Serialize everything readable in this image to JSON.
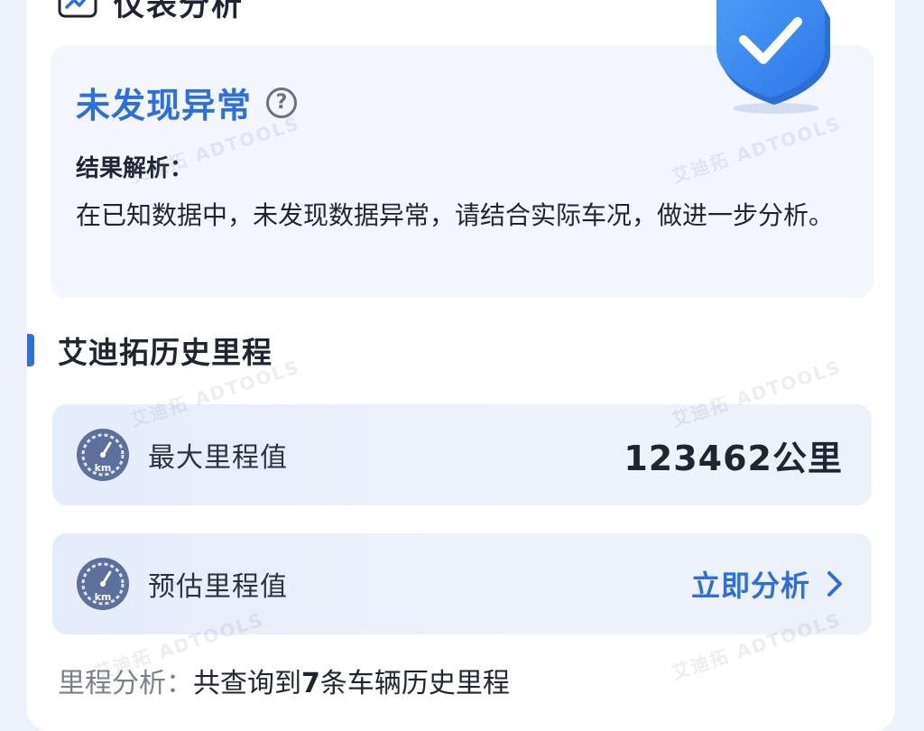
{
  "header": {
    "title": "仪表分析"
  },
  "result": {
    "status": "未发现异常",
    "help_glyph": "?",
    "analysis_label": "结果解析：",
    "analysis_text": "在已知数据中，未发现数据异常，请结合实际车况，做进一步分析。"
  },
  "mileage_section": {
    "title": "艾迪拓历史里程",
    "max_row": {
      "label": "最大里程值",
      "value": "123462公里",
      "icon_unit": "km"
    },
    "estimate_row": {
      "label": "预估里程值",
      "action": "立即分析",
      "icon_unit": "km"
    },
    "summary": {
      "label": "里程分析：",
      "text_before": "共查询到",
      "count": "7",
      "text_after": "条车辆历史里程"
    }
  },
  "watermark": {
    "text": "艾迪拓 ADTOOLS"
  },
  "colors": {
    "accent": "#2b6fe3",
    "shield": "#3b8cf0",
    "text": "#1f2533"
  },
  "icons": [
    "chart-card-icon",
    "help-icon",
    "shield-check-icon",
    "odometer-icon",
    "chevron-right-icon"
  ]
}
